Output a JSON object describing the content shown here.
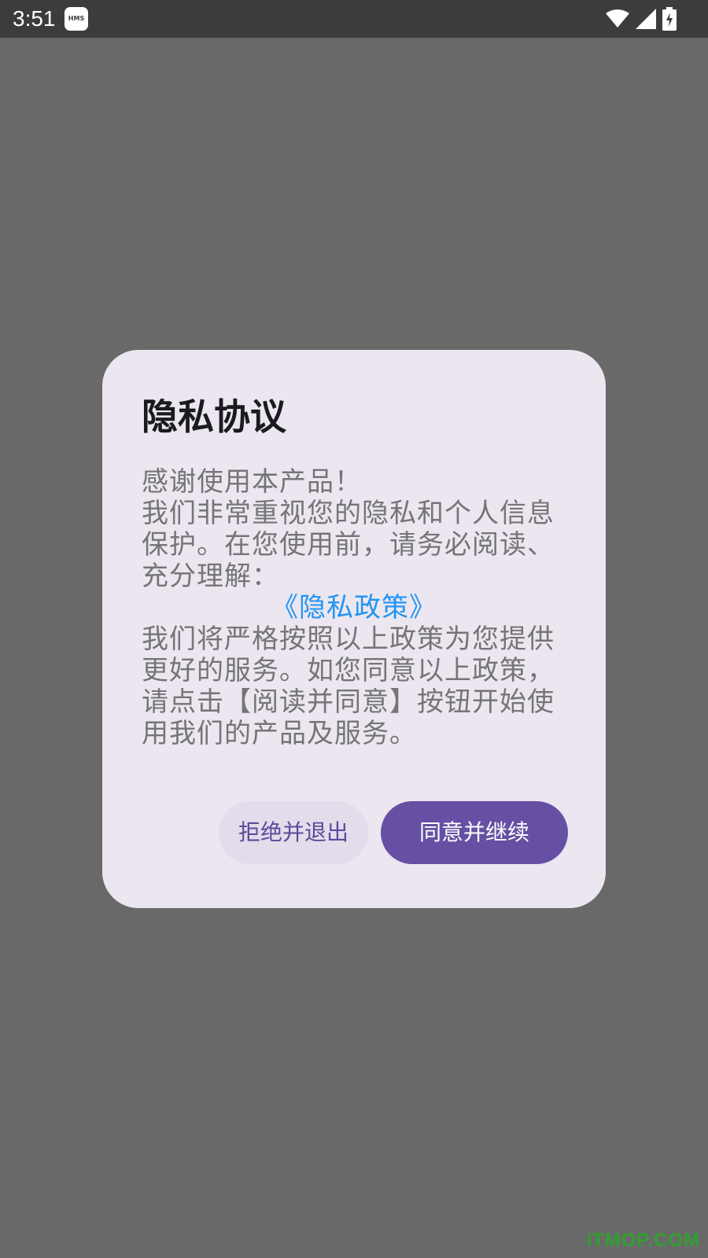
{
  "status_bar": {
    "time": "3:51",
    "hms_label": "HMS",
    "icons": [
      "wifi-icon",
      "signal-icon",
      "battery-charging-icon"
    ]
  },
  "dialog": {
    "title": "隐私协议",
    "body": {
      "line1": "感谢使用本产品！",
      "line2": "我们非常重视您的隐私和个人信息保护。在您使用前，请务必阅读、充分理解：",
      "link": "《隐私政策》",
      "line3": "我们将严格按照以上政策为您提供更好的服务。如您同意以上政策，请点击【阅读并同意】按钮开始使用我们的产品及服务。"
    },
    "reject_button": "拒绝并退出",
    "agree_button": "同意并继续"
  },
  "watermark": "ITMOP.COM",
  "colors": {
    "backdrop": "#696969",
    "status_bar": "#3c3c3c",
    "dialog_bg": "#ebe6f0",
    "link": "#2196f3",
    "primary": "#6650a3",
    "secondary_button_bg": "#e2dceb"
  }
}
